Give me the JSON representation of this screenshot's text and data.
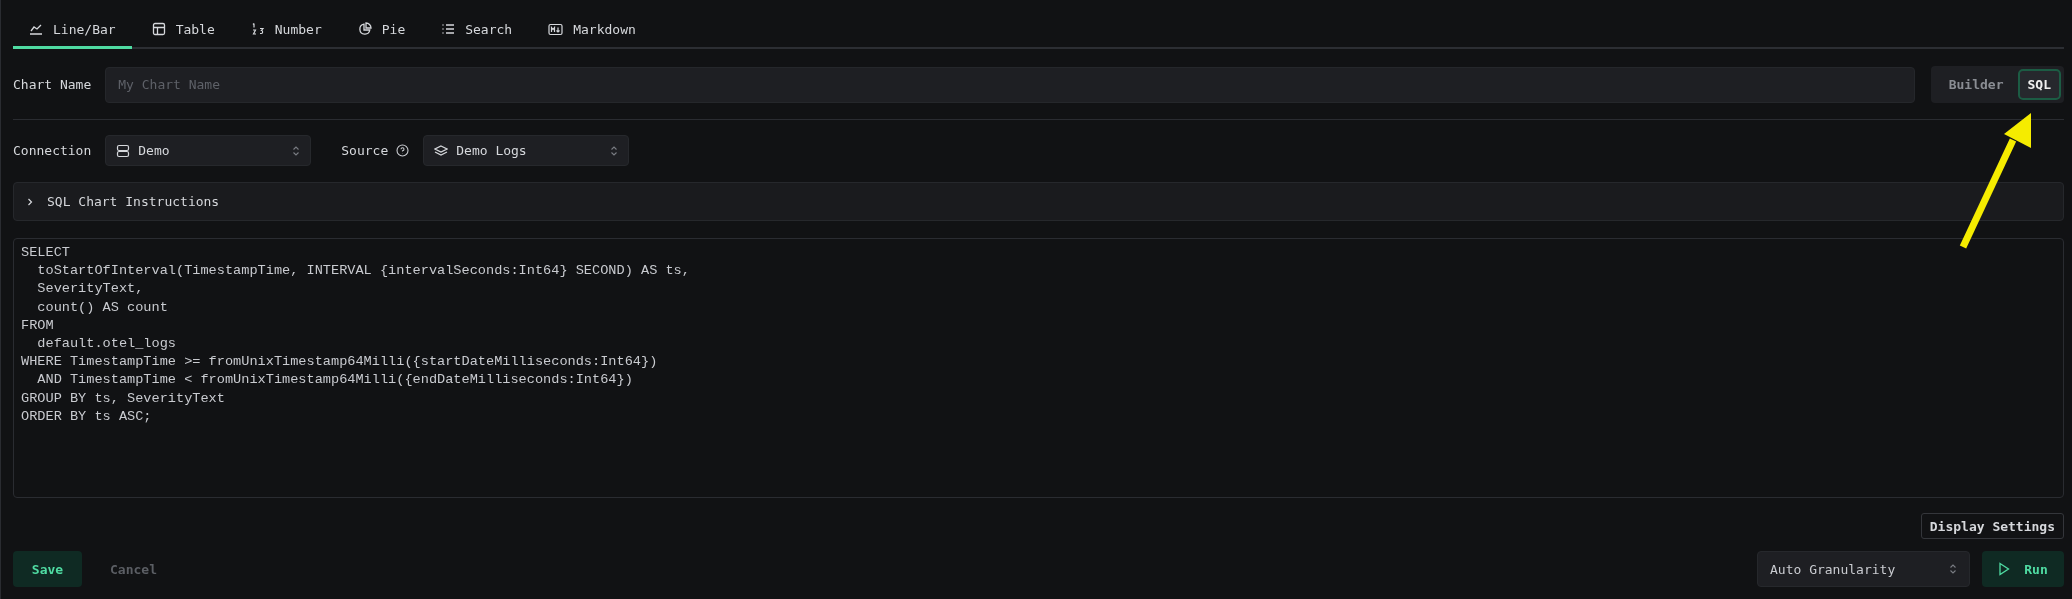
{
  "tabs": [
    {
      "label": "Line/Bar",
      "selected": true
    },
    {
      "label": "Table",
      "selected": false
    },
    {
      "label": "Number",
      "selected": false
    },
    {
      "label": "Pie",
      "selected": false
    },
    {
      "label": "Search",
      "selected": false
    },
    {
      "label": "Markdown",
      "selected": false
    }
  ],
  "chart_name": {
    "label": "Chart Name",
    "placeholder": "My Chart Name"
  },
  "mode_toggle": [
    {
      "label": "Builder",
      "selected": false
    },
    {
      "label": "SQL",
      "selected": true
    }
  ],
  "connection": {
    "label": "Connection",
    "value": "Demo"
  },
  "source": {
    "label": "Source",
    "value": "Demo Logs"
  },
  "instructions": {
    "label": "SQL Chart Instructions",
    "expanded": false
  },
  "sql_editor": {
    "lines": [
      "SELECT",
      "  toStartOfInterval(TimestampTime, INTERVAL {intervalSeconds:Int64} SECOND) AS ts,",
      "  SeverityText,",
      "  count() AS count",
      "FROM",
      "  default.otel_logs",
      "WHERE TimestampTime >= fromUnixTimestamp64Milli({startDateMilliseconds:Int64})",
      "  AND TimestampTime < fromUnixTimestamp64Milli({endDateMilliseconds:Int64})",
      "GROUP BY ts, SeverityText",
      "ORDER BY ts ASC;"
    ]
  },
  "display_settings_button": "Display Settings",
  "save_button": "Save",
  "cancel_button": {
    "label": "Cancel",
    "disabled": true
  },
  "granularity": {
    "value": "Auto Granularity"
  },
  "run_button": "Run"
}
